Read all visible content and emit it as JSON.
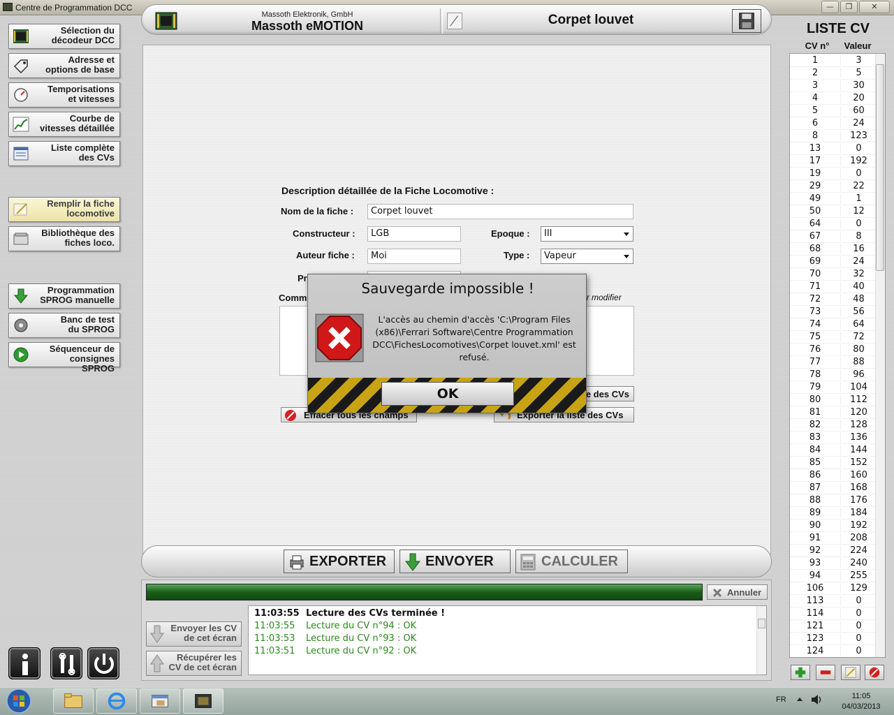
{
  "window": {
    "title": "Centre de Programmation DCC",
    "controls": [
      "minimize",
      "restore",
      "close"
    ]
  },
  "sidebar": {
    "items": [
      {
        "line1": "Sélection du",
        "line2": "décodeur DCC",
        "icon": "chip-icon"
      },
      {
        "line1": "Adresse et",
        "line2": "options de base",
        "icon": "tag-icon"
      },
      {
        "line1": "Temporisations",
        "line2": "et vitesses",
        "icon": "gauge-icon"
      },
      {
        "line1": "Courbe de",
        "line2": "vitesses détaillée",
        "icon": "curve-icon"
      },
      {
        "line1": "Liste complète",
        "line2": "des CVs",
        "icon": "list-icon"
      },
      {
        "line1": "Remplir la fiche",
        "line2": "locomotive",
        "icon": "pencil-icon",
        "active": true
      },
      {
        "line1": "Bibliothèque des",
        "line2": "fiches loco.",
        "icon": "library-icon"
      },
      {
        "line1": "Programmation",
        "line2": "SPROG manuelle",
        "icon": "down-arrow-icon"
      },
      {
        "line1": "Banc de test",
        "line2": "du SPROG",
        "icon": "wheel-icon"
      },
      {
        "line1": "Séquenceur de",
        "line2": "consignes SPROG",
        "icon": "play-icon"
      }
    ],
    "bottom_buttons": [
      "info-icon",
      "tools-icon",
      "power-icon"
    ]
  },
  "header": {
    "manufacturer": "Massoth Elektronik, GmbH",
    "decoder": "Massoth eMOTION",
    "loco_name": "Corpet louvet"
  },
  "form": {
    "section_title": "Description détaillée de la Fiche Locomotive :",
    "nom_label": "Nom de la fiche :",
    "nom_value": "Corpet louvet",
    "constructeur_label": "Constructeur :",
    "constructeur_value": "LGB",
    "auteur_label": "Auteur fiche :",
    "auteur_value": "Moi",
    "epoque_label": "Epoque :",
    "epoque_value": "III",
    "type_label": "Type :",
    "type_value": "Vapeur",
    "partial_label_1": "Pr",
    "partial_label_2": "Comm",
    "partial_modifier": "ur modifier",
    "btn_effacer": "Effacer tous les champs",
    "btn_exporter_cvs": "Exporter la liste des CVs",
    "btn_partial_cvs": "e des CVs"
  },
  "modal": {
    "title": "Sauvegarde impossible !",
    "message_lines": [
      "L'accès au chemin d'accès 'C:\\Program Files",
      "(x86)\\Ferrari Software\\Centre Programmation",
      "DCC\\FichesLocomotives\\Corpet louvet.xml' est",
      "refusé."
    ],
    "ok_label": "OK"
  },
  "actions": {
    "exporter": "EXPORTER",
    "envoyer": "ENVOYER",
    "calculer": "CALCULER"
  },
  "status": {
    "progress_percent": 100,
    "annuler": "Annuler",
    "envoyer_cv": {
      "line1": "Envoyer les CV",
      "line2": "de cet écran"
    },
    "recuperer_cv": {
      "line1": "Récupérer les",
      "line2": "CV de cet écran"
    },
    "log": [
      {
        "time": "11:03:55",
        "text": "Lecture des CVs terminée !",
        "bold": true,
        "color": "#111111"
      },
      {
        "time": "11:03:55",
        "text": "Lecture du CV n°94 : OK",
        "bold": false,
        "color": "#2a8a1a"
      },
      {
        "time": "11:03:53",
        "text": "Lecture du CV n°93 : OK",
        "bold": false,
        "color": "#2a8a1a"
      },
      {
        "time": "11:03:51",
        "text": "Lecture du CV n°92 : OK",
        "bold": false,
        "color": "#2a8a1a"
      }
    ]
  },
  "cv_list": {
    "title": "LISTE CV",
    "col_num": "CV n°",
    "col_val": "Valeur",
    "rows": [
      [
        "1",
        "3"
      ],
      [
        "2",
        "5"
      ],
      [
        "3",
        "30"
      ],
      [
        "4",
        "20"
      ],
      [
        "5",
        "60"
      ],
      [
        "6",
        "24"
      ],
      [
        "8",
        "123"
      ],
      [
        "13",
        "0"
      ],
      [
        "17",
        "192"
      ],
      [
        "19",
        "0"
      ],
      [
        "29",
        "22"
      ],
      [
        "49",
        "1"
      ],
      [
        "50",
        "12"
      ],
      [
        "64",
        "0"
      ],
      [
        "67",
        "8"
      ],
      [
        "68",
        "16"
      ],
      [
        "69",
        "24"
      ],
      [
        "70",
        "32"
      ],
      [
        "71",
        "40"
      ],
      [
        "72",
        "48"
      ],
      [
        "73",
        "56"
      ],
      [
        "74",
        "64"
      ],
      [
        "75",
        "72"
      ],
      [
        "76",
        "80"
      ],
      [
        "77",
        "88"
      ],
      [
        "78",
        "96"
      ],
      [
        "79",
        "104"
      ],
      [
        "80",
        "112"
      ],
      [
        "81",
        "120"
      ],
      [
        "82",
        "128"
      ],
      [
        "83",
        "136"
      ],
      [
        "84",
        "144"
      ],
      [
        "85",
        "152"
      ],
      [
        "86",
        "160"
      ],
      [
        "87",
        "168"
      ],
      [
        "88",
        "176"
      ],
      [
        "89",
        "184"
      ],
      [
        "90",
        "192"
      ],
      [
        "91",
        "208"
      ],
      [
        "92",
        "224"
      ],
      [
        "93",
        "240"
      ],
      [
        "94",
        "255"
      ],
      [
        "106",
        "129"
      ],
      [
        "113",
        "0"
      ],
      [
        "114",
        "0"
      ],
      [
        "121",
        "0"
      ],
      [
        "123",
        "0"
      ],
      [
        "124",
        "0"
      ]
    ],
    "tools": [
      "add-icon",
      "remove-icon",
      "edit-icon",
      "delete-icon"
    ]
  },
  "taskbar": {
    "lang": "FR",
    "time": "11:05",
    "date": "04/03/2013"
  }
}
